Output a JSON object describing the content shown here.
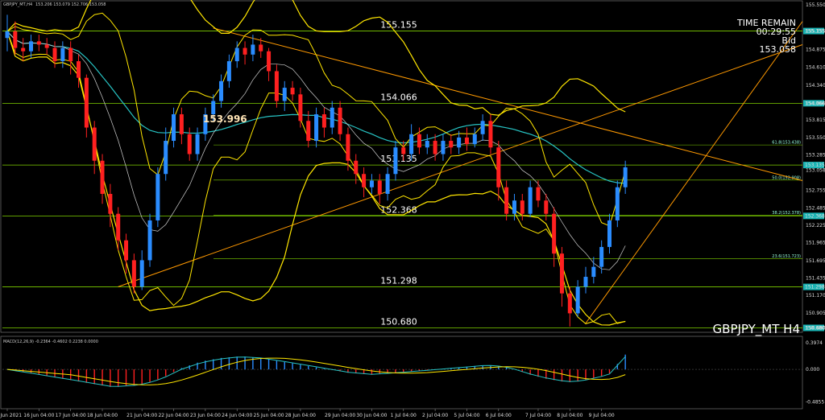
{
  "header": {
    "main_title": "GBPJPY_MT,H4",
    "main_values": "153.206 153.079 152.706 153.058",
    "macd_title": "MACD(12,26,9) -0.2364 -0.4602 0.2238 0.0000"
  },
  "info": {
    "time_remain_label": "TIME REMAIN",
    "time_remain_value": "00:29:55",
    "bid_label": "Bid",
    "bid_value": "153.058",
    "symbol_caption": "GBPJPY_MT H4"
  },
  "annotation": {
    "price_label": "153.996",
    "color": "#ffe4b5"
  },
  "colors": {
    "up": "#2a8cff",
    "down": "#ff2020",
    "level": "#7fd000",
    "band": "#ffe600",
    "trend": "#ff9900",
    "ma": "#27c4c4",
    "macd_signal": "#ffe600",
    "macd_line": "#27c4c4"
  },
  "chart_data": [
    {
      "type": "candlestick",
      "ylim": [
        150.65,
        155.55
      ],
      "y_ticks": [
        "155.550",
        "155.155",
        "154.875",
        "154.610",
        "154.340",
        "154.066",
        "153.815",
        "153.550",
        "153.285",
        "153.058",
        "152.755",
        "152.485",
        "152.225",
        "151.965",
        "151.695",
        "151.435",
        "151.170",
        "150.905",
        "150.680"
      ],
      "x_labels": [
        "15 Jun 2021",
        "16 Jun 04:00",
        "17 Jun 04:00",
        "18 Jun 04:00",
        "21 Jun 04:00",
        "22 Jun 04:00",
        "23 Jun 04:00",
        "24 Jun 04:00",
        "25 Jun 04:00",
        "28 Jun 04:00",
        "29 Jun 04:00",
        "30 Jun 04:00",
        "1 Jul 04:00",
        "2 Jul 04:00",
        "5 Jul 04:00",
        "6 Jul 04:00",
        "7 Jul 04:00",
        "8 Jul 04:00",
        "9 Jul 04:00"
      ],
      "levels": [
        {
          "value": 155.155,
          "label": "155.155",
          "tag": "155.155"
        },
        {
          "value": 154.066,
          "label": "154.066",
          "tag": "154.066"
        },
        {
          "value": 153.135,
          "label": "153.135",
          "tag": "153.135"
        },
        {
          "value": 152.368,
          "label": "152.368",
          "tag": "152.368"
        },
        {
          "value": 151.298,
          "label": "151.298",
          "tag": "151.298"
        },
        {
          "value": 150.68,
          "label": "150.680",
          "tag": "150.680"
        }
      ],
      "fib_levels": [
        {
          "value": 153.438,
          "label": "61.8(153.438)"
        },
        {
          "value": 152.908,
          "label": "50.0(152.908)"
        },
        {
          "value": 152.378,
          "label": "38.2(152.378)"
        },
        {
          "value": 151.723,
          "label": "23.6(151.723)"
        }
      ],
      "candles": [
        [
          155.05,
          155.15,
          155.4,
          154.85
        ],
        [
          155.15,
          154.9,
          155.3,
          154.8
        ],
        [
          154.9,
          154.85,
          155.05,
          154.7
        ],
        [
          154.85,
          155.0,
          155.1,
          154.75
        ],
        [
          155.0,
          154.95,
          155.1,
          154.85
        ],
        [
          154.95,
          154.9,
          155.05,
          154.8
        ],
        [
          154.9,
          154.7,
          155.0,
          154.6
        ],
        [
          154.7,
          154.9,
          155.0,
          154.6
        ],
        [
          154.9,
          154.7,
          155.0,
          154.5
        ],
        [
          154.7,
          154.45,
          154.8,
          154.3
        ],
        [
          154.45,
          153.7,
          154.5,
          153.55
        ],
        [
          153.7,
          153.2,
          153.8,
          153.0
        ],
        [
          153.2,
          152.7,
          153.3,
          152.55
        ],
        [
          152.7,
          152.4,
          152.85,
          152.2
        ],
        [
          152.4,
          152.0,
          152.5,
          151.85
        ],
        [
          152.0,
          151.7,
          152.1,
          151.5
        ],
        [
          151.7,
          151.3,
          151.8,
          151.2
        ],
        [
          151.3,
          151.7,
          151.85,
          151.25
        ],
        [
          151.7,
          152.3,
          152.4,
          151.6
        ],
        [
          152.3,
          153.0,
          153.1,
          152.2
        ],
        [
          153.0,
          153.5,
          153.7,
          152.9
        ],
        [
          153.5,
          153.9,
          154.0,
          153.4
        ],
        [
          153.9,
          153.6,
          154.0,
          153.45
        ],
        [
          153.6,
          153.3,
          153.7,
          153.2
        ],
        [
          153.3,
          153.6,
          153.7,
          153.2
        ],
        [
          153.6,
          153.9,
          154.0,
          153.5
        ],
        [
          153.9,
          154.1,
          154.2,
          153.8
        ],
        [
          154.1,
          154.4,
          154.5,
          154.0
        ],
        [
          154.4,
          154.7,
          154.8,
          154.3
        ],
        [
          154.7,
          154.9,
          155.0,
          154.6
        ],
        [
          154.9,
          154.8,
          155.0,
          154.65
        ],
        [
          154.8,
          154.95,
          155.1,
          154.7
        ],
        [
          154.95,
          154.85,
          155.05,
          154.75
        ],
        [
          154.85,
          154.55,
          154.9,
          154.4
        ],
        [
          154.55,
          154.1,
          154.65,
          154.0
        ],
        [
          154.1,
          154.3,
          154.4,
          153.95
        ],
        [
          154.3,
          154.2,
          154.4,
          154.1
        ],
        [
          154.2,
          153.8,
          154.3,
          153.7
        ],
        [
          153.8,
          153.5,
          153.95,
          153.4
        ],
        [
          153.5,
          153.9,
          154.0,
          153.4
        ],
        [
          153.9,
          153.7,
          154.0,
          153.55
        ],
        [
          153.7,
          154.0,
          154.1,
          153.6
        ],
        [
          154.0,
          153.6,
          154.1,
          153.5
        ],
        [
          153.6,
          153.2,
          153.7,
          153.05
        ],
        [
          153.2,
          153.0,
          153.3,
          152.85
        ],
        [
          153.0,
          152.8,
          153.1,
          152.65
        ],
        [
          152.8,
          152.9,
          153.0,
          152.7
        ],
        [
          152.9,
          152.7,
          153.0,
          152.55
        ],
        [
          152.7,
          153.0,
          153.1,
          152.6
        ],
        [
          153.0,
          153.4,
          153.5,
          152.9
        ],
        [
          153.4,
          153.3,
          153.5,
          153.2
        ],
        [
          153.3,
          153.6,
          153.75,
          153.2
        ],
        [
          153.6,
          153.4,
          153.7,
          153.3
        ],
        [
          153.4,
          153.5,
          153.6,
          153.3
        ],
        [
          153.5,
          153.3,
          153.6,
          153.2
        ],
        [
          153.3,
          153.5,
          153.6,
          153.2
        ],
        [
          153.5,
          153.4,
          153.6,
          153.3
        ],
        [
          153.4,
          153.55,
          153.65,
          153.3
        ],
        [
          153.55,
          153.45,
          153.7,
          153.35
        ],
        [
          153.45,
          153.6,
          153.7,
          153.4
        ],
        [
          153.6,
          153.8,
          153.9,
          153.5
        ],
        [
          153.8,
          153.4,
          153.9,
          153.3
        ],
        [
          153.4,
          152.8,
          153.5,
          152.6
        ],
        [
          152.8,
          152.4,
          152.9,
          152.3
        ],
        [
          152.4,
          152.6,
          152.7,
          152.3
        ],
        [
          152.6,
          152.4,
          152.7,
          152.3
        ],
        [
          152.4,
          152.8,
          152.9,
          152.35
        ],
        [
          152.8,
          152.6,
          152.9,
          152.5
        ],
        [
          152.6,
          152.4,
          152.7,
          152.3
        ],
        [
          152.4,
          151.8,
          152.5,
          151.6
        ],
        [
          151.8,
          151.2,
          151.9,
          151.0
        ],
        [
          151.2,
          150.9,
          151.3,
          150.7
        ],
        [
          150.9,
          151.3,
          151.4,
          150.85
        ],
        [
          151.3,
          151.45,
          151.6,
          151.2
        ],
        [
          151.45,
          151.6,
          151.75,
          151.35
        ],
        [
          151.6,
          151.9,
          152.0,
          151.5
        ],
        [
          151.9,
          152.3,
          152.4,
          151.8
        ],
        [
          152.3,
          152.8,
          152.9,
          152.2
        ],
        [
          152.8,
          153.1,
          153.2,
          152.7
        ]
      ]
    },
    {
      "type": "bar",
      "title": "MACD(12,26,9)",
      "ylim": [
        -0.55,
        0.42
      ],
      "y_ticks": [
        "0.3974",
        "0.000",
        "-0.4855"
      ],
      "values": [
        0.0,
        -0.02,
        -0.04,
        -0.06,
        -0.08,
        -0.1,
        -0.12,
        -0.14,
        -0.16,
        -0.18,
        -0.2,
        -0.22,
        -0.24,
        -0.26,
        -0.26,
        -0.25,
        -0.24,
        -0.22,
        -0.19,
        -0.15,
        -0.1,
        -0.04,
        0.02,
        0.06,
        0.1,
        0.13,
        0.15,
        0.17,
        0.18,
        0.19,
        0.19,
        0.18,
        0.17,
        0.15,
        0.13,
        0.11,
        0.09,
        0.07,
        0.05,
        0.03,
        0.01,
        -0.01,
        -0.03,
        -0.05,
        -0.06,
        -0.07,
        -0.08,
        -0.07,
        -0.06,
        -0.05,
        -0.04,
        -0.03,
        -0.02,
        -0.01,
        0.0,
        0.01,
        0.02,
        0.03,
        0.04,
        0.05,
        0.06,
        0.06,
        0.05,
        0.03,
        0.0,
        -0.04,
        -0.08,
        -0.11,
        -0.14,
        -0.16,
        -0.18,
        -0.19,
        -0.18,
        -0.16,
        -0.13,
        -0.1,
        -0.06,
        0.08,
        0.22
      ]
    }
  ]
}
